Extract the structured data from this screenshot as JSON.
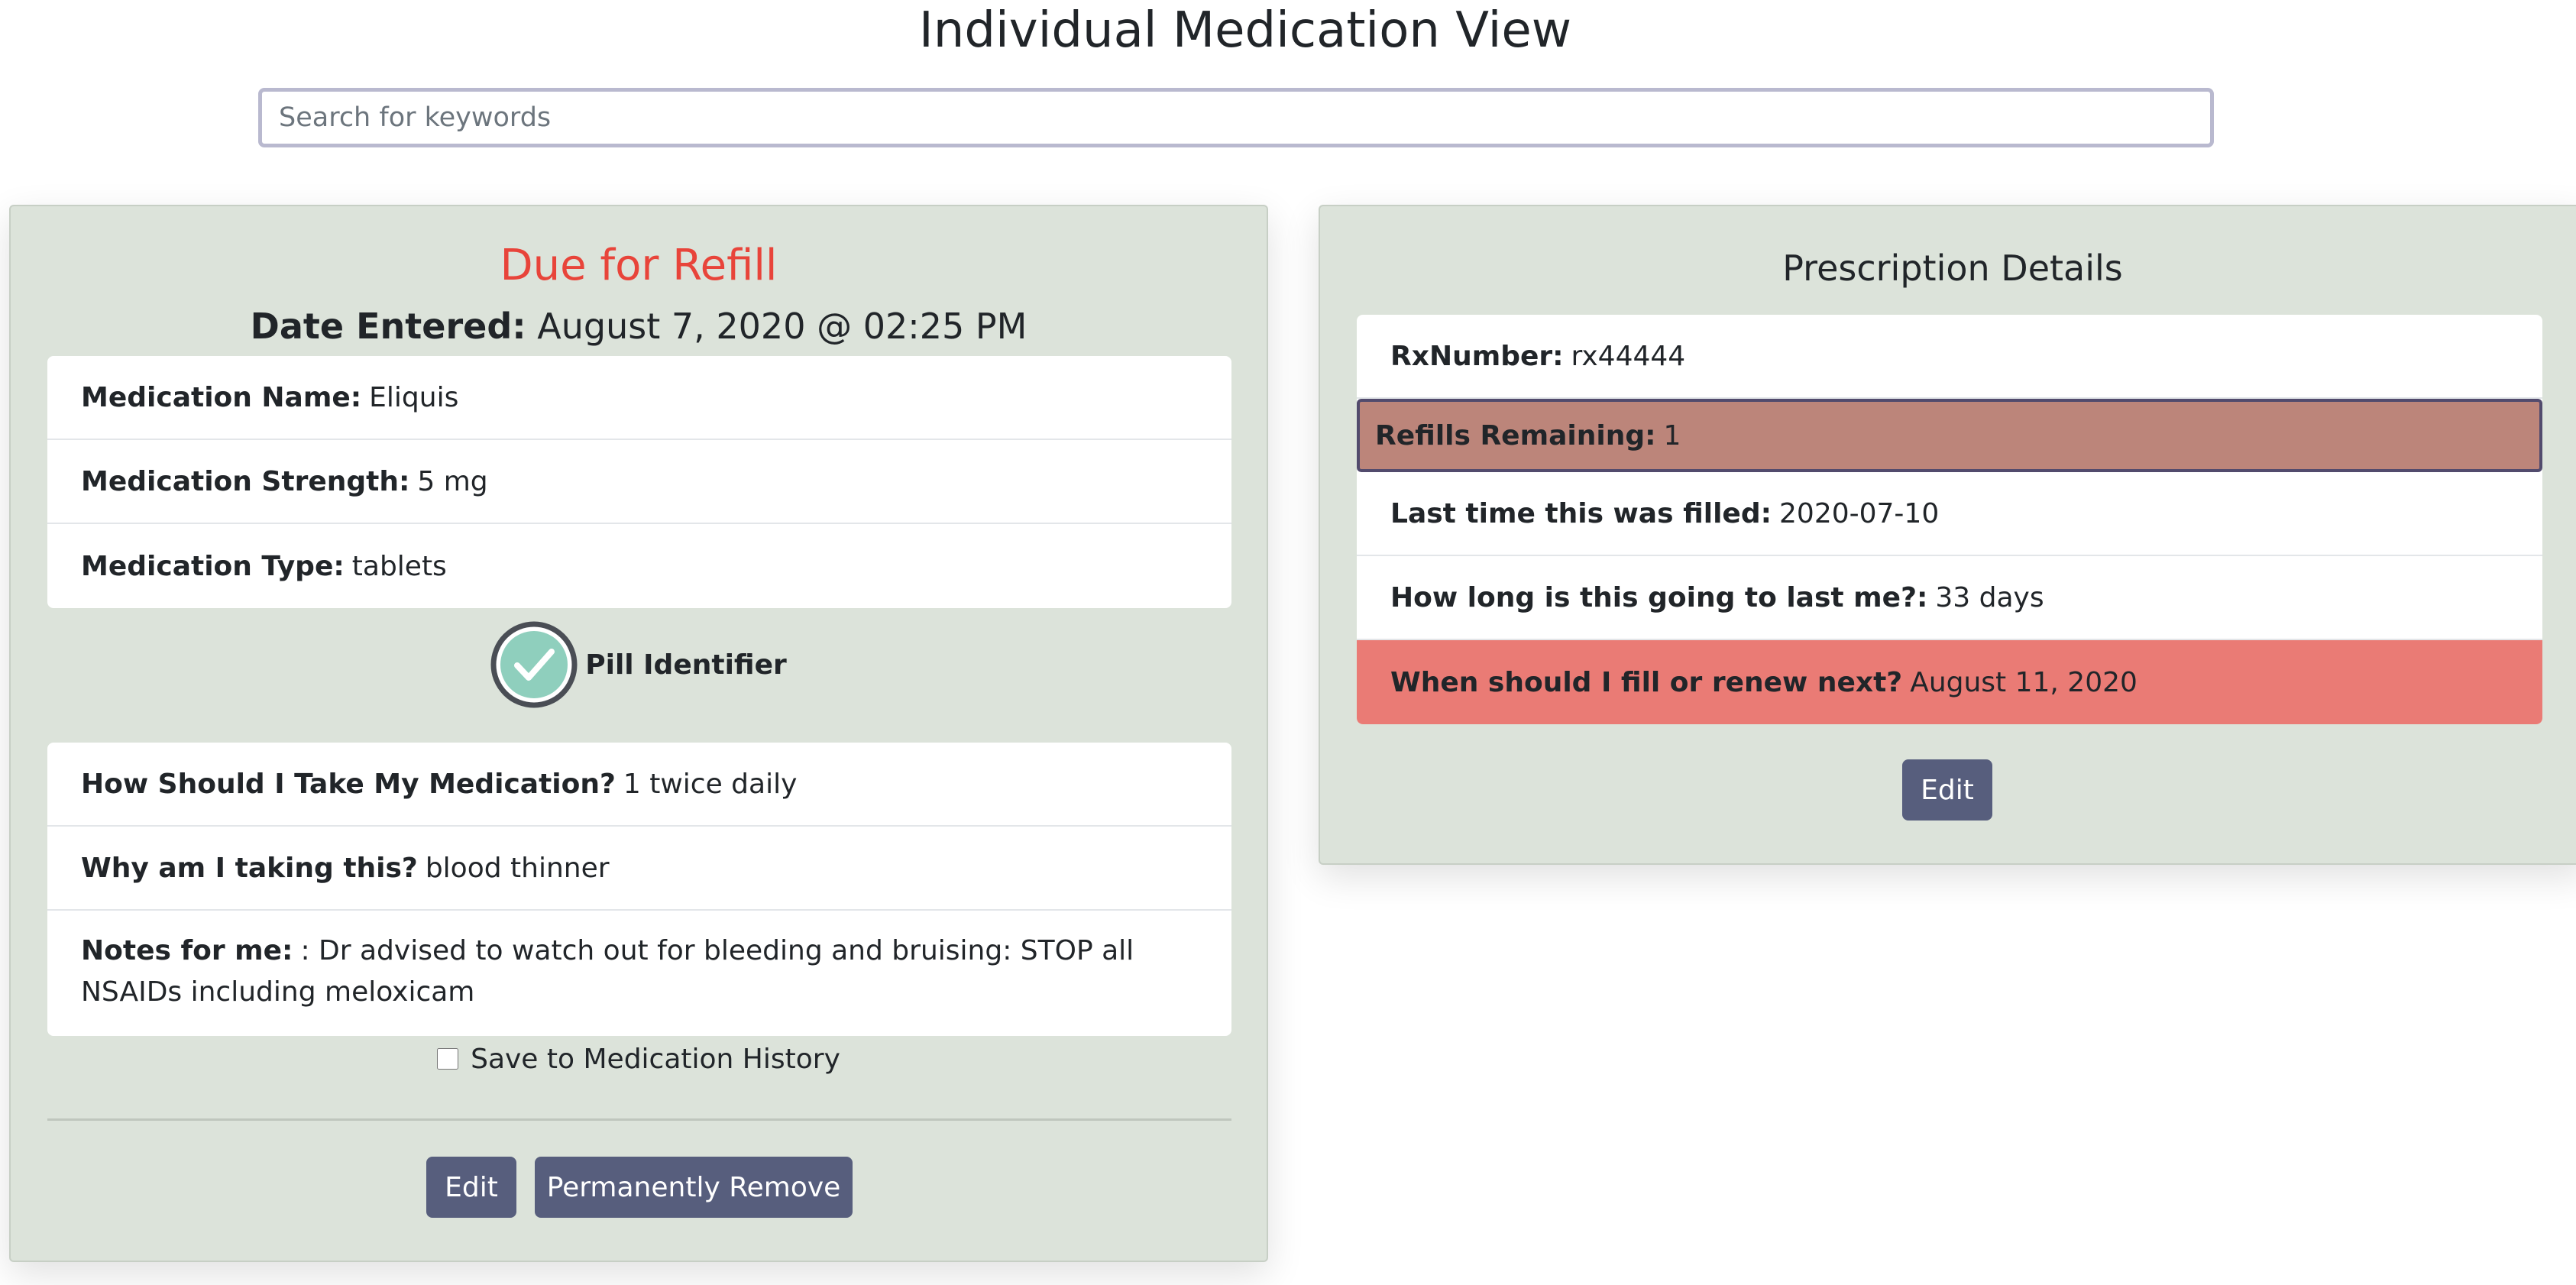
{
  "page": {
    "title": "Individual Medication View"
  },
  "search": {
    "placeholder": "Search for keywords"
  },
  "medication_card": {
    "status": "Due for Refill",
    "date_label": "Date Entered:",
    "date_value": "August 7, 2020 @ 02:25 PM",
    "details": [
      {
        "label": "Medication Name:",
        "value": "Eliquis"
      },
      {
        "label": "Medication Strength:",
        "value": "5 mg"
      },
      {
        "label": "Medication Type:",
        "value": "tablets"
      }
    ],
    "pill_identifier_label": "Pill Identifier",
    "instructions": [
      {
        "label": "How Should I Take My Medication?",
        "value": "1 twice daily"
      },
      {
        "label": "Why am I taking this?",
        "value": "blood thinner"
      },
      {
        "label": "Notes for me:",
        "value": ": Dr advised to watch out for bleeding and bruising: STOP all NSAIDs including meloxicam"
      }
    ],
    "save_history_label": "Save to Medication History",
    "save_history_checked": false,
    "edit_label": "Edit",
    "remove_label": "Permanently Remove"
  },
  "prescription_card": {
    "title": "Prescription Details",
    "items": [
      {
        "label": "RxNumber:",
        "value": "rx44444"
      },
      {
        "label": "Refills Remaining:",
        "value": "1"
      },
      {
        "label": "Last time this was filled:",
        "value": "2020-07-10"
      },
      {
        "label": "How long is this going to last me?:",
        "value": "33 days"
      },
      {
        "label": "When should I fill or renew next?",
        "value": "August 11, 2020"
      }
    ],
    "edit_label": "Edit"
  },
  "colors": {
    "status_due": "#e8443a",
    "card_background": "#dce3da",
    "button": "#575e7d",
    "refills_highlight": "#bc857a",
    "next_fill_alert": "#ea7b75",
    "pill_check": "#8fcfbd"
  },
  "icons": {
    "pill_identifier": "check-circle-icon"
  }
}
